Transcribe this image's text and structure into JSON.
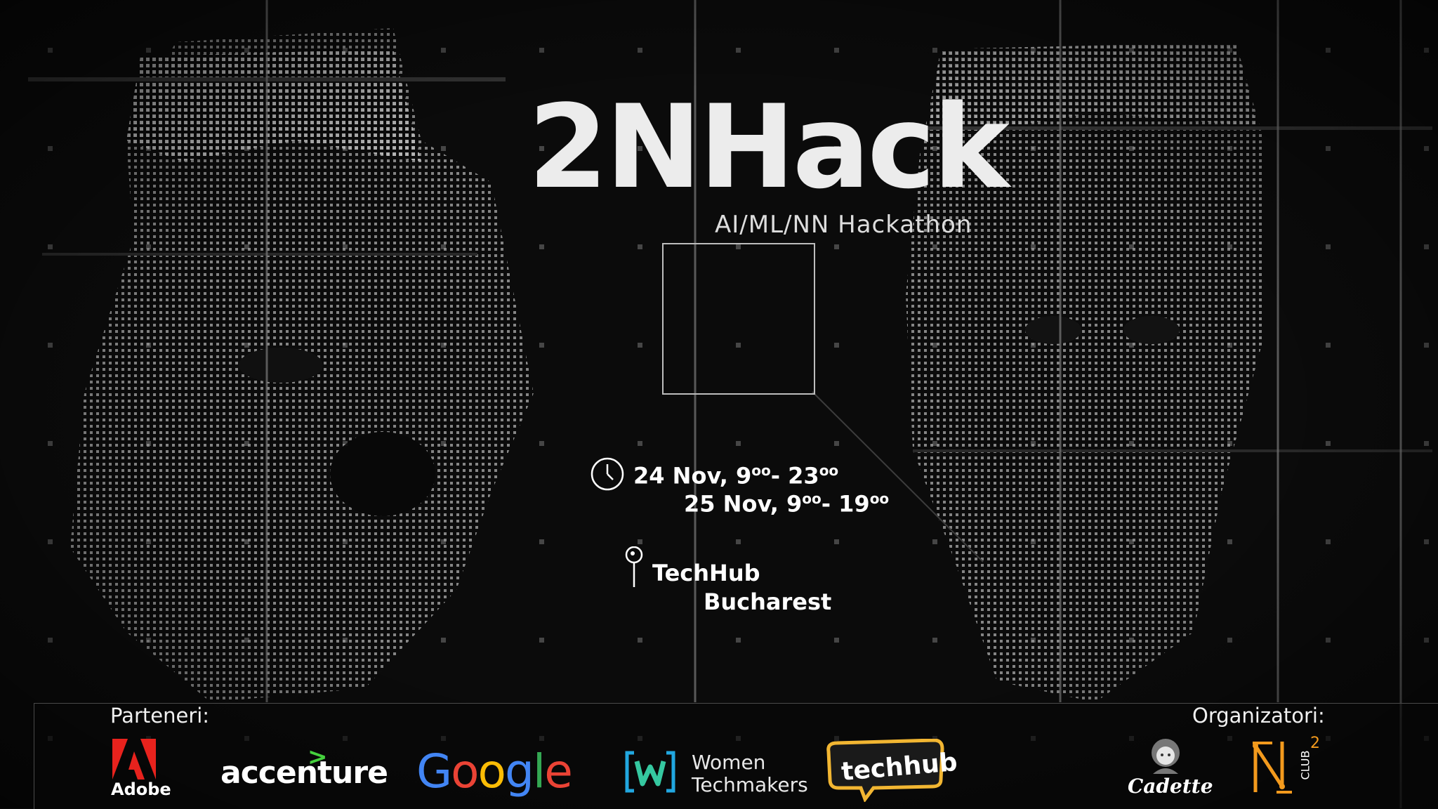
{
  "event": {
    "title": "2NHack",
    "subtitle": "AI/ML/NN Hackathon"
  },
  "schedule": {
    "day1": "24 Nov, 9",
    "day1_start_sup": "oo",
    "day1_mid": "- 23",
    "day1_end_sup": "oo",
    "day2": "25 Nov, 9",
    "day2_start_sup": "oo",
    "day2_mid": "- 19",
    "day2_end_sup": "oo"
  },
  "location": {
    "line1": "TechHub",
    "line2": "Bucharest"
  },
  "footer": {
    "partners_label": "Parteneri:",
    "organizers_label": "Organizatori:",
    "partners": [
      {
        "name": "Adobe"
      },
      {
        "name": "accenture"
      },
      {
        "name": "Google"
      },
      {
        "name": "Women Techmakers",
        "line1": "Women",
        "line2": "Techmakers"
      },
      {
        "name": "techhub"
      }
    ],
    "organizers": [
      {
        "name": "Cadette"
      },
      {
        "name": "N² CLUB",
        "sup": "2",
        "vertical": "CLUB"
      }
    ]
  },
  "colors": {
    "background": "#0b0b0b",
    "title": "#ececec",
    "adobe_red": "#e8221d",
    "accenture_green": "#45d13d",
    "google_blue": "#4285f4",
    "google_red": "#ea4335",
    "google_yellow": "#fbbc05",
    "google_green": "#34a853",
    "techhub_gold": "#f2b632",
    "wt_cyan": "#21a7e0",
    "nclub_orange": "#f39a1d"
  }
}
